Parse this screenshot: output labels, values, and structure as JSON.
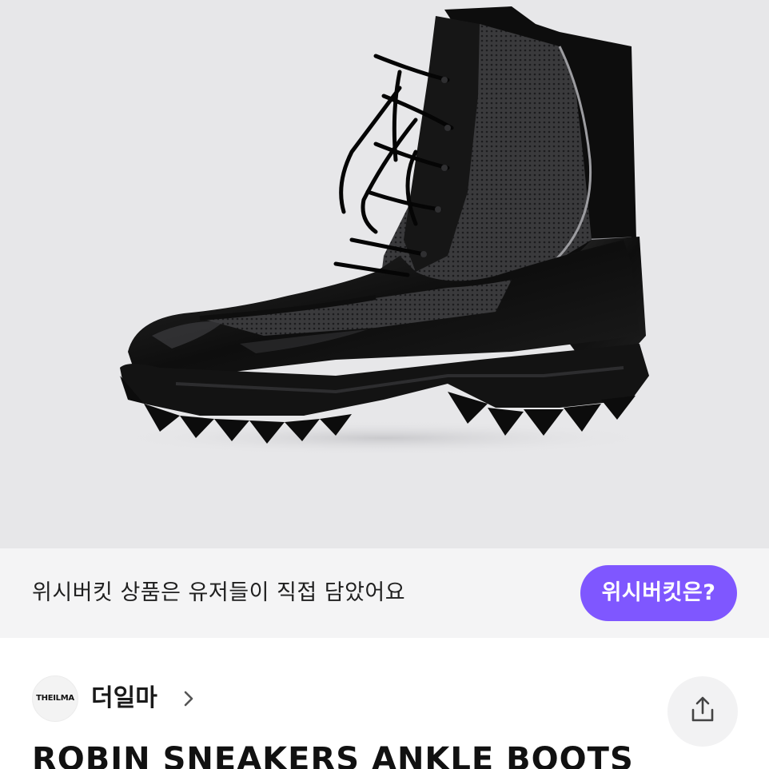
{
  "hero": {
    "image": "black-ankle-boot-photo",
    "background": "#e7e7e9"
  },
  "banner": {
    "text": "위시버킷 상품은 유저들이 직접 담았어요",
    "button_label": "위시버킷은?",
    "button_color": "#7f57ff"
  },
  "seller": {
    "avatar_text": "THEILMA",
    "name": "더일마",
    "chevron_icon": "chevron-right-icon"
  },
  "share": {
    "icon": "share-icon"
  },
  "product": {
    "title": "ROBIN SNEAKERS ANKLE BOOTS"
  }
}
